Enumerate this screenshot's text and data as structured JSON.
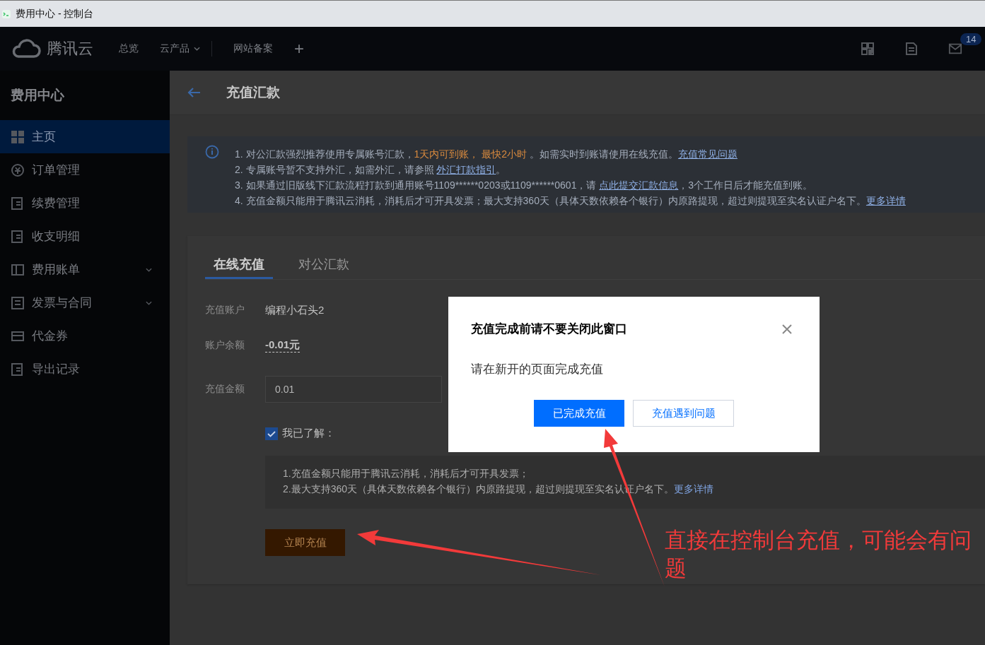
{
  "window": {
    "title": "费用中心 - 控制台"
  },
  "topnav": {
    "brand": "腾讯云",
    "items": [
      {
        "label": "总览",
        "dropdown": false
      },
      {
        "label": "云产品",
        "dropdown": true
      },
      {
        "label": "网站备案",
        "dropdown": false
      }
    ],
    "add": "+",
    "badge": "14"
  },
  "sidebar": {
    "title": "费用中心",
    "items": [
      {
        "label": "主页",
        "selected": true,
        "expandable": false
      },
      {
        "label": "订单管理",
        "selected": false,
        "expandable": false
      },
      {
        "label": "续费管理",
        "selected": false,
        "expandable": false
      },
      {
        "label": "收支明细",
        "selected": false,
        "expandable": false
      },
      {
        "label": "费用账单",
        "selected": false,
        "expandable": true
      },
      {
        "label": "发票与合同",
        "selected": false,
        "expandable": true
      },
      {
        "label": "代金券",
        "selected": false,
        "expandable": false
      },
      {
        "label": "导出记录",
        "selected": false,
        "expandable": false
      }
    ]
  },
  "header": {
    "title": "充值汇款"
  },
  "notice": [
    [
      {
        "kind": "text",
        "text": "1. 对公汇款强烈推荐使用专属账号汇款，"
      },
      {
        "kind": "highlight",
        "text": "1天内可到账，"
      },
      {
        "kind": "highlight",
        "text": " 最快2小时"
      },
      {
        "kind": "text",
        "text": " 。如需实时到账请使用在线充值。"
      },
      {
        "kind": "link",
        "text": "充值常见问题"
      }
    ],
    [
      {
        "kind": "text",
        "text": "2. 专属账号暂不支持外汇，如需外汇，请参照 "
      },
      {
        "kind": "link",
        "text": "外汇打款指引"
      },
      {
        "kind": "text",
        "text": "。"
      }
    ],
    [
      {
        "kind": "text",
        "text": "3. 如果通过旧版线下汇款流程打款到通用账号1109******0203或1109******0601，请 "
      },
      {
        "kind": "link",
        "text": "点此提交汇款信息"
      },
      {
        "kind": "text",
        "text": "，3个工作日后才能充值到账。"
      }
    ],
    [
      {
        "kind": "text",
        "text": "4. 充值金额只能用于腾讯云消耗，消耗后才可开具发票；最大支持360天（具体天数依赖各个银行）内原路提现，超过则提现至实名认证户名下。"
      },
      {
        "kind": "link",
        "text": "更多详情"
      }
    ]
  ],
  "tabs": [
    {
      "label": "在线充值",
      "selected": true
    },
    {
      "label": "对公汇款",
      "selected": false
    }
  ],
  "form": {
    "account_label": "充值账户",
    "account": "编程小石头2",
    "balance_label": "账户余额",
    "balance": "-0.01元",
    "amount_label": "充值金额",
    "amount": "0.01"
  },
  "agree": {
    "label": "我已了解：",
    "checked": true
  },
  "terms": [
    [
      {
        "kind": "text",
        "text": "1.充值金额只能用于腾讯云消耗，消耗后才可开具发票；"
      }
    ],
    [
      {
        "kind": "text",
        "text": "2.最大支持360天（具体天数依赖各个银行）内原路提现，超过则提现至实名认证户名下。"
      },
      {
        "kind": "link",
        "text": "更多详情"
      }
    ]
  ],
  "submit": "立即充值",
  "dialog": {
    "title": "充值完成前请不要关闭此窗口",
    "body": "请在新开的页面完成充值",
    "buttons": [
      {
        "label": "已完成充值",
        "kind": "primary"
      },
      {
        "label": "充值遇到问题",
        "kind": "secondary"
      }
    ]
  },
  "annotation": {
    "text": "直接在控制台充值，可能会有问题"
  }
}
